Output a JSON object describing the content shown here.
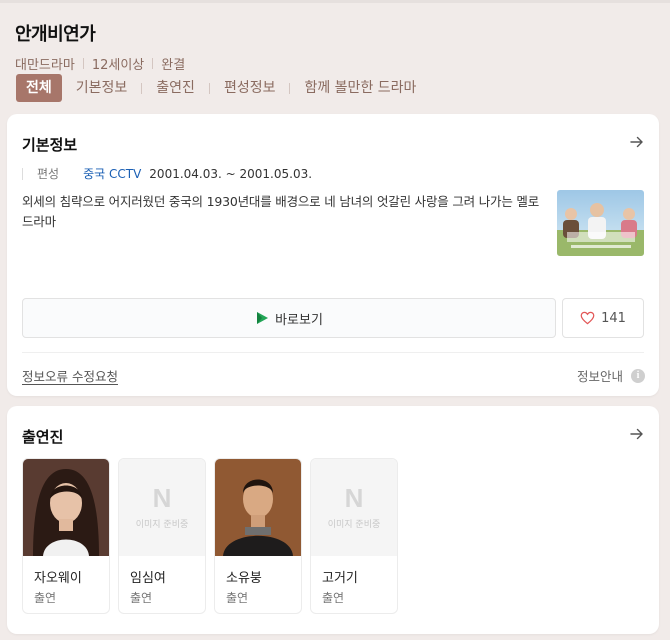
{
  "header": {
    "title": "안개비연가",
    "meta": [
      "대만드라마",
      "12세이상",
      "완결"
    ]
  },
  "tabs": [
    {
      "label": "전체",
      "active": true
    },
    {
      "label": "기본정보"
    },
    {
      "label": "출연진"
    },
    {
      "label": "편성정보"
    },
    {
      "label": "함께 볼만한 드라마"
    }
  ],
  "basic_info": {
    "title": "기본정보",
    "broadcast_label": "편성",
    "channel": "중국 CCTV",
    "dates": "2001.04.03. ~ 2001.05.03.",
    "description": "외세의 침략으로 어지러웠던 중국의 1930년대를 배경으로 네 남녀의 엇갈린 사랑을 그려 나가는 멜로 드라마",
    "watch_label": "바로보기",
    "like_count": "141",
    "report_label": "정보오류 수정요청",
    "info_label": "정보안내",
    "info_icon_char": "i"
  },
  "cast": {
    "title": "출연진",
    "placeholder_logo": "N",
    "placeholder_text": "이미지 준비중",
    "members": [
      {
        "name": "자오웨이",
        "role": "출연",
        "has_photo": true
      },
      {
        "name": "임심여",
        "role": "출연",
        "has_photo": false
      },
      {
        "name": "소유붕",
        "role": "출연",
        "has_photo": true
      },
      {
        "name": "고거기",
        "role": "출연",
        "has_photo": false
      }
    ]
  },
  "colors": {
    "accent": "#a7766a",
    "meta_text": "#8a6b60",
    "channel_link": "#1a5fb4",
    "page_bg": "#f1ebe9"
  }
}
